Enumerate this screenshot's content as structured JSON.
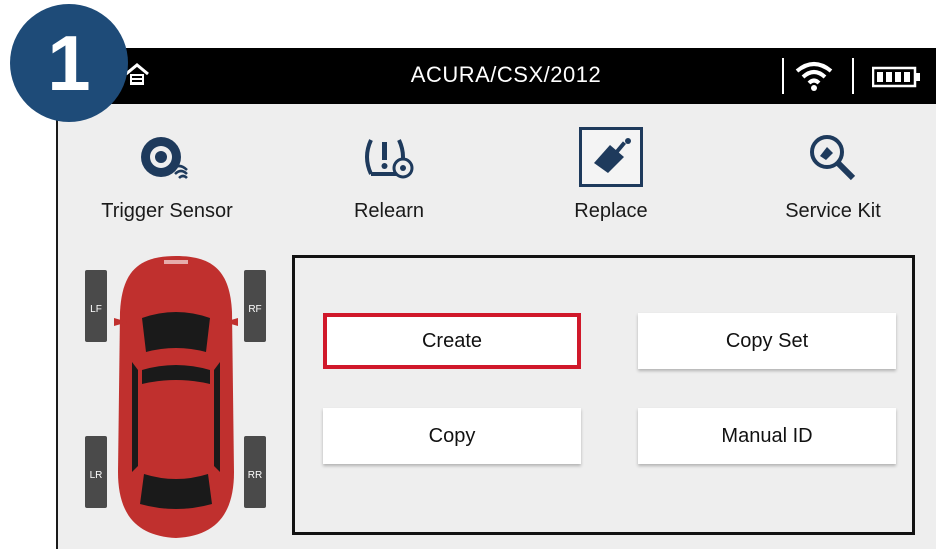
{
  "step_number": "1",
  "header": {
    "title": "ACURA/CSX/2012",
    "icons": [
      "home-icon",
      "wifi-icon",
      "battery-icon"
    ]
  },
  "toolbar": {
    "items": [
      {
        "label": "Trigger Sensor",
        "icon": "tire-sensor-icon"
      },
      {
        "label": "Relearn",
        "icon": "tpms-warning-icon"
      },
      {
        "label": "Replace",
        "icon": "sensor-replace-icon",
        "selected": true
      },
      {
        "label": "Service Kit",
        "icon": "magnifier-sensor-icon"
      }
    ]
  },
  "vehicle": {
    "tires": {
      "lf": "LF",
      "rf": "RF",
      "lr": "LR",
      "rr": "RR"
    },
    "car_color": "#c0302e"
  },
  "panel": {
    "buttons": {
      "create": "Create",
      "copy_set": "Copy Set",
      "copy": "Copy",
      "manual_id": "Manual ID"
    },
    "selected": "Create"
  },
  "colors": {
    "badge": "#1e4b78",
    "selection_border": "#d0182a",
    "frame": "#1e3a5c"
  }
}
